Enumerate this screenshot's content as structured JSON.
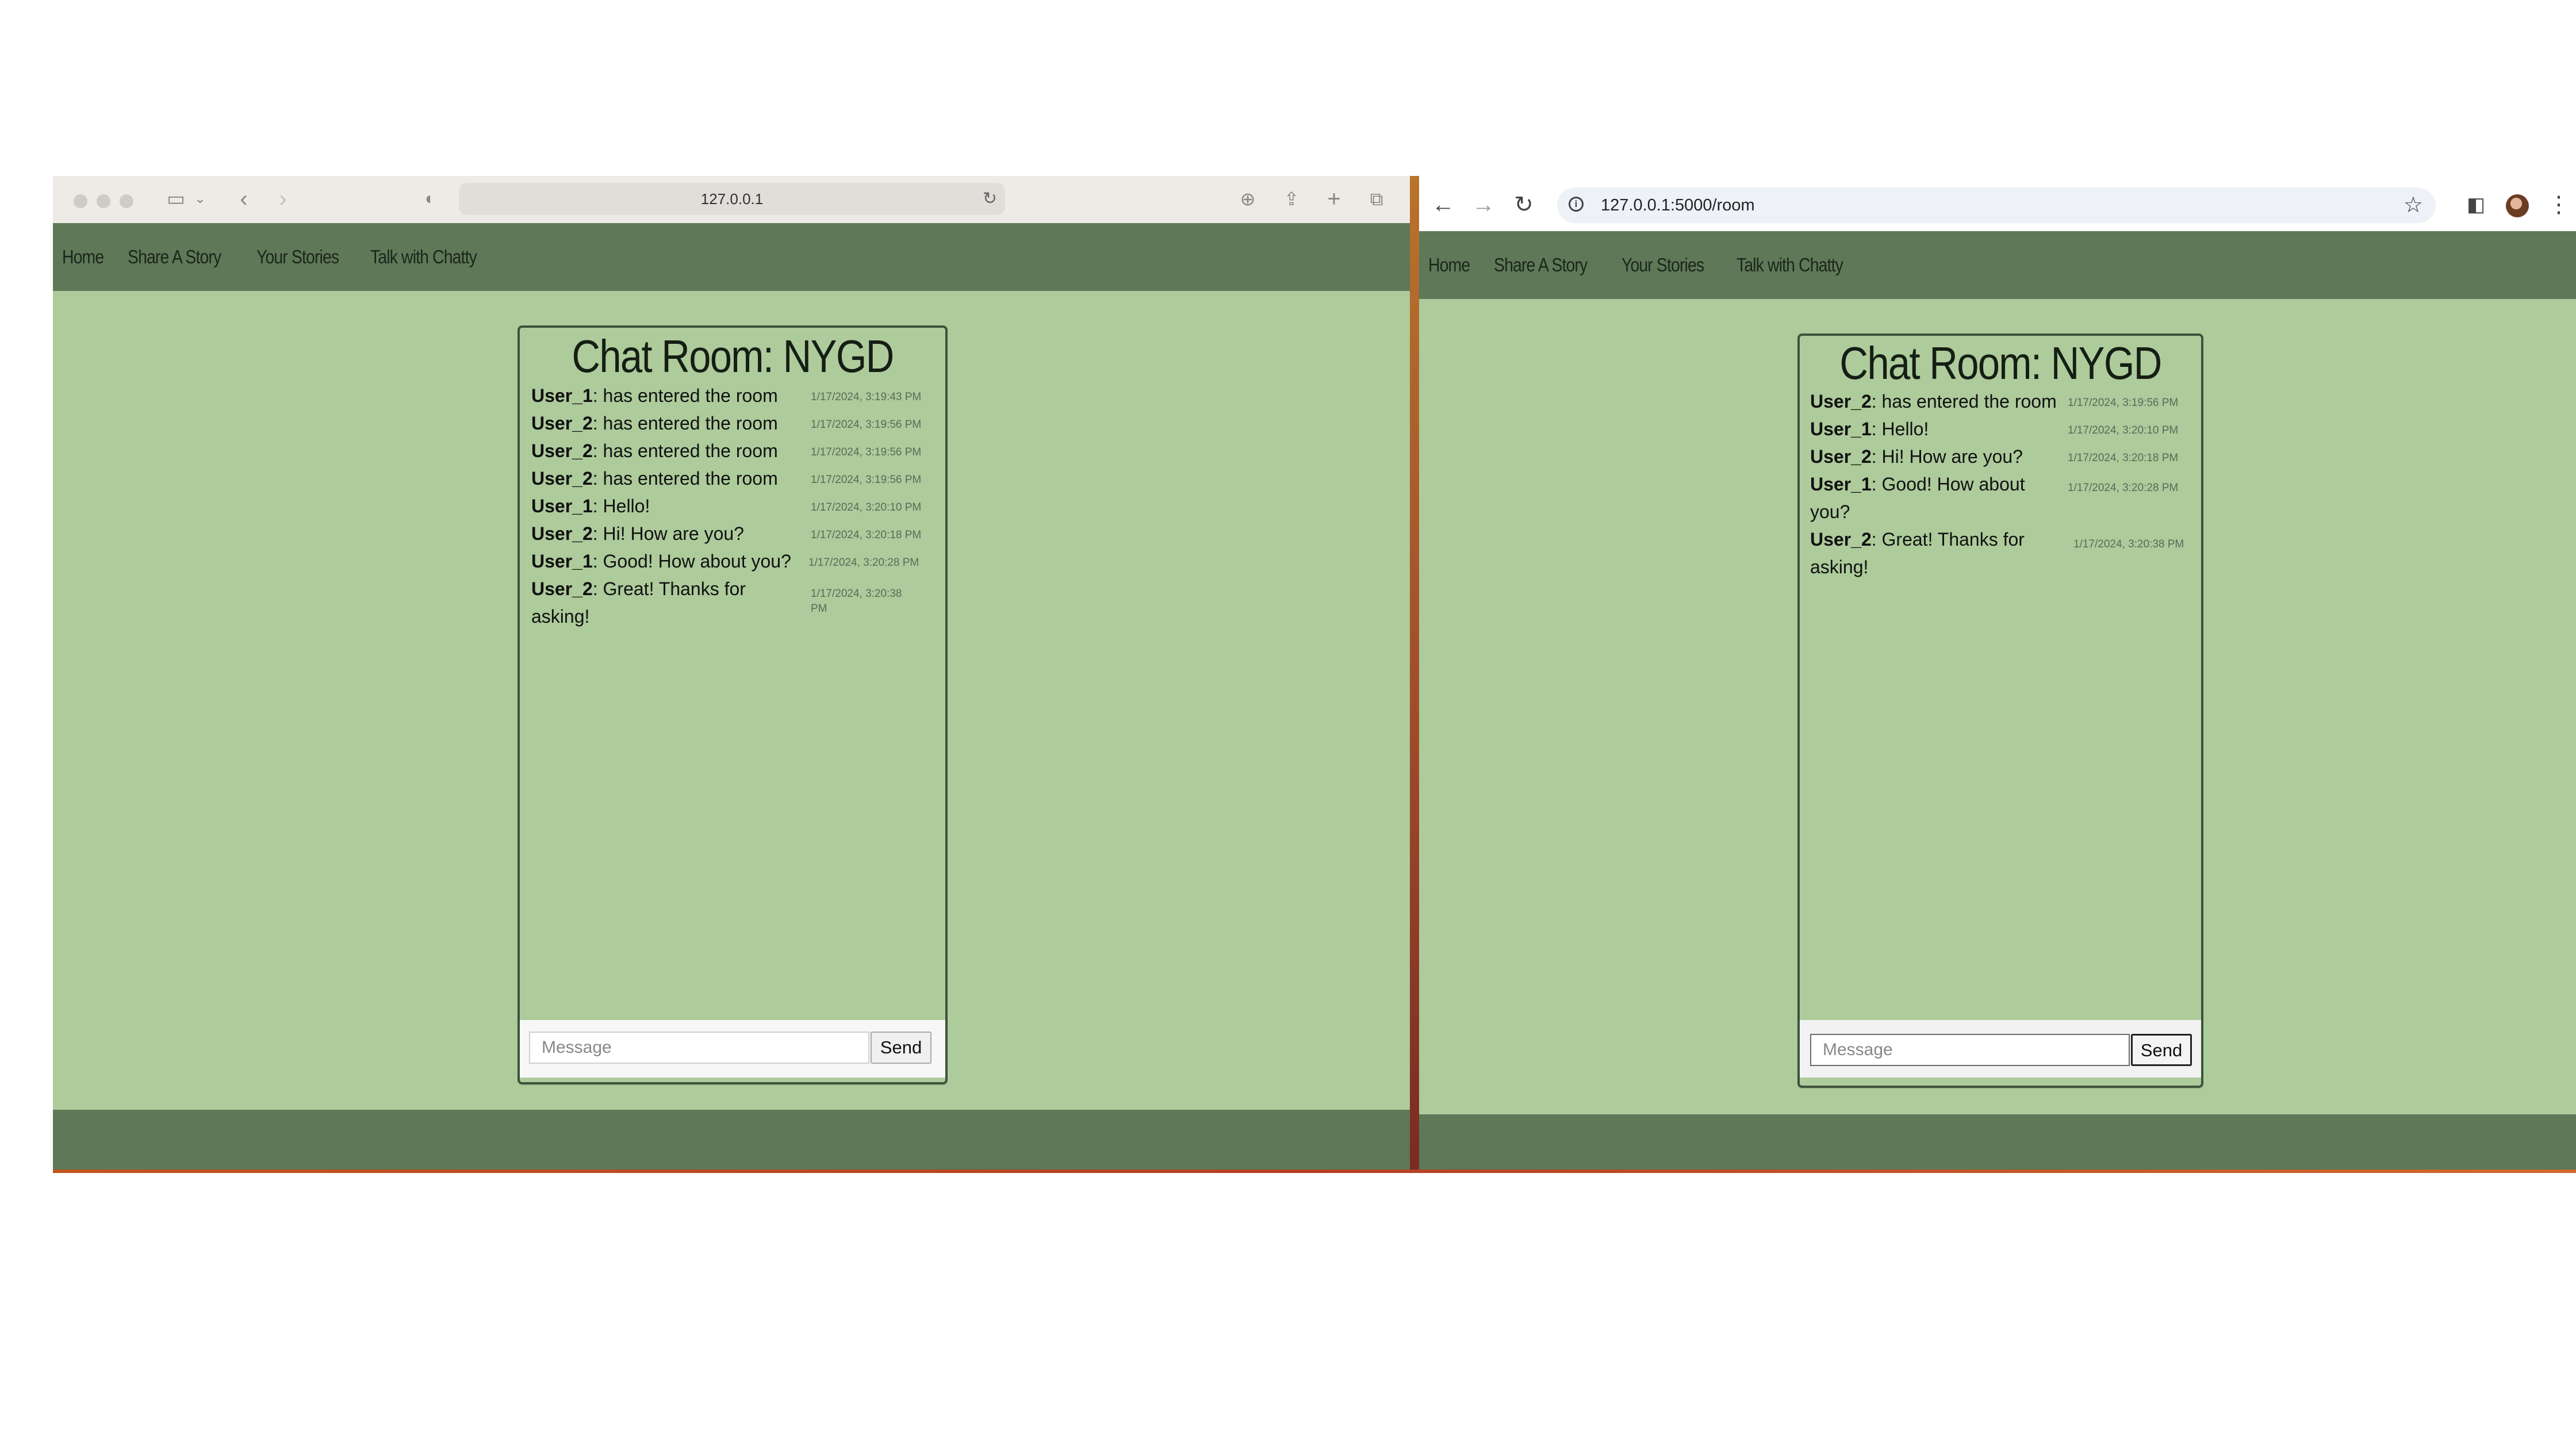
{
  "colors": {
    "page_bg": "#adcb9b",
    "nav_bg": "#5f7857",
    "card_border": "#3e523a"
  },
  "left_window": {
    "browser": "Safari",
    "address_bar": "127.0.0.1",
    "nav": [
      "Home",
      "Share A Story",
      "Your Stories",
      "Talk with Chatty"
    ],
    "chat": {
      "title": "Chat Room: NYGD",
      "messages": [
        {
          "user": "User_1",
          "text": ": has entered the room",
          "time": "1/17/2024, 3:19:43 PM"
        },
        {
          "user": "User_2",
          "text": ": has entered the room",
          "time": "1/17/2024, 3:19:56 PM"
        },
        {
          "user": "User_2",
          "text": ": has entered the room",
          "time": "1/17/2024, 3:19:56 PM"
        },
        {
          "user": "User_2",
          "text": ": has entered the room",
          "time": "1/17/2024, 3:19:56 PM"
        },
        {
          "user": "User_1",
          "text": ": Hello!",
          "time": "1/17/2024, 3:20:10 PM"
        },
        {
          "user": "User_2",
          "text": ": Hi! How are you?",
          "time": "1/17/2024, 3:20:18 PM"
        },
        {
          "user": "User_1",
          "text": ": Good! How about you?",
          "time": "1/17/2024, 3:20:28 PM"
        },
        {
          "user": "User_2",
          "text": ": Great! Thanks for asking!",
          "time": "1/17/2024, 3:20:38 PM"
        }
      ],
      "input_placeholder": "Message",
      "send_label": "Send"
    }
  },
  "right_window": {
    "browser": "Chrome",
    "address_bar": "127.0.0.1:5000/room",
    "nav": [
      "Home",
      "Share A Story",
      "Your Stories",
      "Talk with Chatty"
    ],
    "chat": {
      "title": "Chat Room: NYGD",
      "messages": [
        {
          "user": "User_2",
          "text": ": has entered the room",
          "time": "1/17/2024, 3:19:56 PM"
        },
        {
          "user": "User_1",
          "text": ": Hello!",
          "time": "1/17/2024, 3:20:10 PM"
        },
        {
          "user": "User_2",
          "text": ": Hi! How are you?",
          "time": "1/17/2024, 3:20:18 PM"
        },
        {
          "user": "User_1",
          "text": ": Good! How about you?",
          "time": "1/17/2024, 3:20:28 PM"
        },
        {
          "user": "User_2",
          "text": ": Great! Thanks for asking!",
          "time": "1/17/2024, 3:20:38 PM"
        }
      ],
      "input_placeholder": "Message",
      "send_label": "Send"
    }
  }
}
